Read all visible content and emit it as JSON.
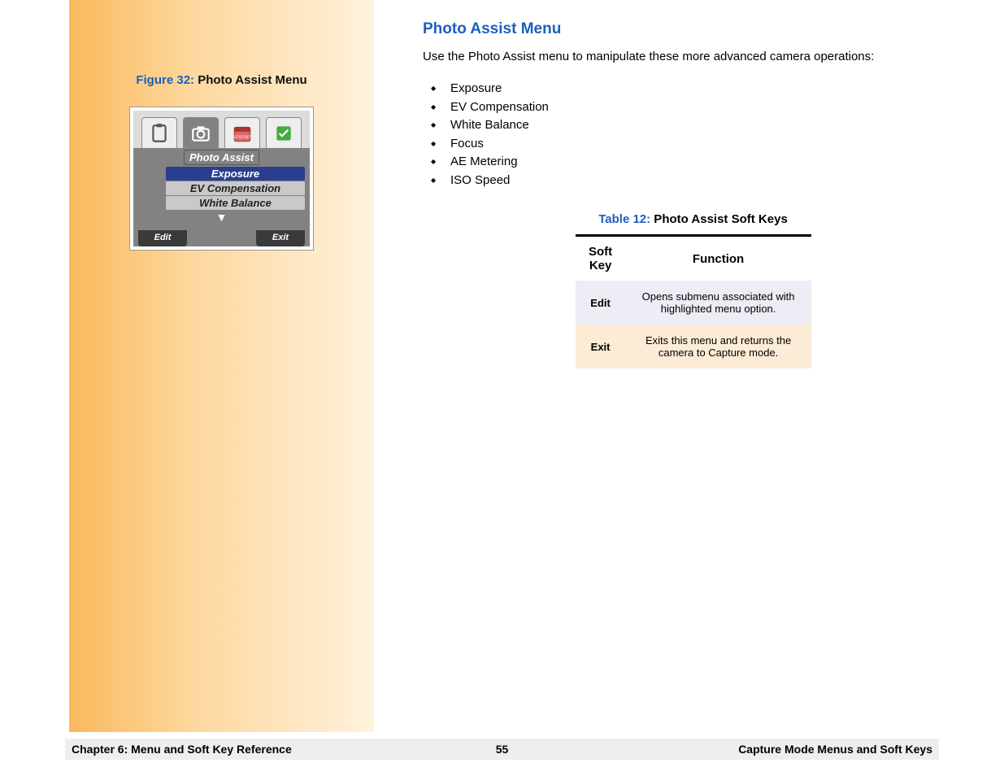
{
  "left": {
    "figure_label": "Figure 32:",
    "figure_title": " Photo Assist Menu",
    "screenshot": {
      "menu_title": "Photo Assist",
      "items": [
        "Exposure",
        "EV Compensation",
        "White Balance"
      ],
      "highlighted_index": 0,
      "date_badge": "07/07/97",
      "soft_left": "Edit",
      "soft_right": "Exit"
    }
  },
  "right": {
    "section_title": "Photo Assist Menu",
    "intro": "Use the Photo Assist menu to manipulate these more advanced camera operations:",
    "bullets": [
      "Exposure",
      "EV Compensation",
      "White Balance",
      "Focus",
      "AE Metering",
      "ISO Speed"
    ],
    "table": {
      "caption_label": "Table 12:",
      "caption_title": " Photo Assist Soft Keys",
      "headers": [
        "Soft Key",
        "Function"
      ],
      "rows": [
        {
          "key": "Edit",
          "func": "Opens submenu associated with highlighted menu option."
        },
        {
          "key": "Exit",
          "func": "Exits this menu and returns the camera to Capture mode."
        }
      ]
    }
  },
  "footer": {
    "left": "Chapter 6: Menu and Soft Key Reference",
    "center": "55",
    "right": "Capture Mode Menus and Soft Keys"
  }
}
